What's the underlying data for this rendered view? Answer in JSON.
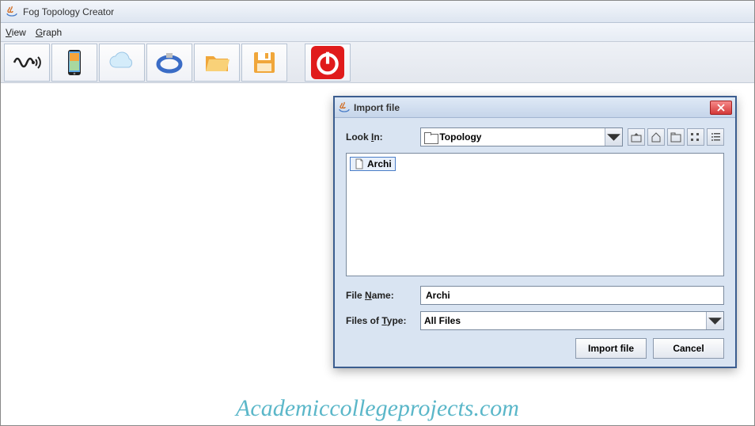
{
  "app": {
    "title": "Fog Topology Creator"
  },
  "menubar": {
    "view": "View",
    "graph": "Graph"
  },
  "toolbar": {
    "sensor": "sensor-icon",
    "phone": "phone-icon",
    "cloud": "cloud-icon",
    "link": "link-icon",
    "folder": "folder-icon",
    "save": "save-icon",
    "power": "power-icon"
  },
  "dialog": {
    "title": "Import file",
    "lookin_label": "Look In:",
    "lookin_value": "Topology",
    "files": [
      {
        "name": "Archi"
      }
    ],
    "filename_label": "File Name:",
    "filename_value": "Archi",
    "filetype_label": "Files of Type:",
    "filetype_value": "All Files",
    "import_btn": "Import file",
    "cancel_btn": "Cancel"
  },
  "watermark": "Academiccollegeprojects.com"
}
